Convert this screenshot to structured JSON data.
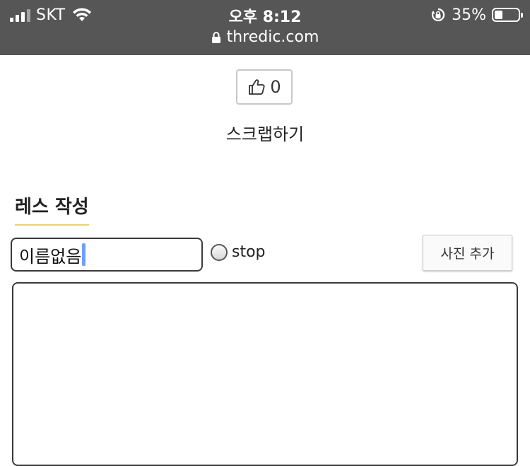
{
  "status_bar": {
    "carrier": "SKT",
    "time": "오후 8:12",
    "battery_percent": "35%",
    "battery_level": 0.35,
    "url": "thredic.com"
  },
  "like": {
    "count": "0",
    "icon": "thumbs-up-icon"
  },
  "scrap_label": "스크랩하기",
  "reply_form": {
    "title": "레스 작성",
    "name_value": "이름없음",
    "stop_label": "stop",
    "photo_button": "사진 추가",
    "body_value": ""
  },
  "colors": {
    "statusbar_bg": "#565656",
    "title_underline": "#f0d060",
    "caret": "#6fa0ff"
  }
}
